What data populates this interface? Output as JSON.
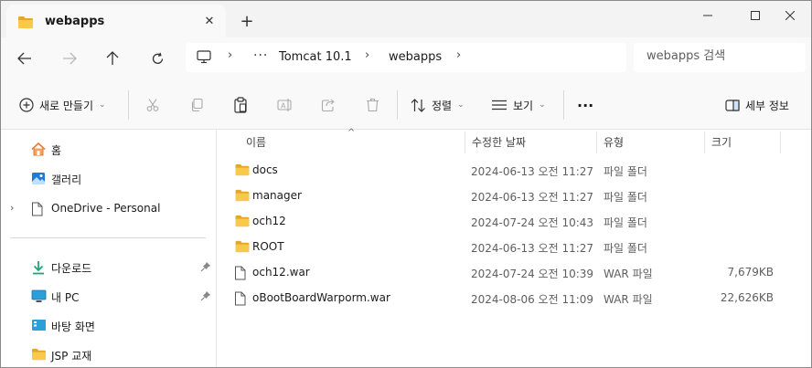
{
  "tab": {
    "title": "webapps",
    "close_glyph": "✕",
    "new_tab_glyph": "+"
  },
  "window_controls": {
    "minimize": "minimize-icon",
    "maximize": "maximize-icon",
    "close": "close-icon"
  },
  "address": {
    "overflow": "···",
    "separator": "›",
    "crumbs": [
      "Tomcat 10.1",
      "webapps"
    ]
  },
  "search": {
    "placeholder": "webapps 검색"
  },
  "toolbar": {
    "new_label": "새로 만들기",
    "sort_label": "정렬",
    "view_label": "보기",
    "more_label": "···",
    "details_label": "세부 정보",
    "chevron": "⌄"
  },
  "sidebar": {
    "items": [
      {
        "label": "홈",
        "icon": "home-icon"
      },
      {
        "label": "갤러리",
        "icon": "gallery-icon"
      },
      {
        "label": "OneDrive - Personal",
        "icon": "document-icon",
        "expand": "›"
      },
      {
        "label": "다운로드",
        "icon": "download-icon",
        "pinned": true
      },
      {
        "label": "내 PC",
        "icon": "monitor-icon",
        "pinned": true
      },
      {
        "label": "바탕 화면",
        "icon": "desktop-icon"
      },
      {
        "label": "JSP 교재",
        "icon": "folder-icon"
      }
    ]
  },
  "columns": {
    "name": "이름",
    "modified": "수정한 날짜",
    "type": "유형",
    "size": "크기",
    "sort_glyph": "^"
  },
  "files": [
    {
      "name": "docs",
      "modified": "2024-06-13 오전 11:27",
      "type": "파일 폴더",
      "size": "",
      "kind": "folder"
    },
    {
      "name": "manager",
      "modified": "2024-06-13 오전 11:27",
      "type": "파일 폴더",
      "size": "",
      "kind": "folder"
    },
    {
      "name": "och12",
      "modified": "2024-07-24 오전 10:43",
      "type": "파일 폴더",
      "size": "",
      "kind": "folder"
    },
    {
      "name": "ROOT",
      "modified": "2024-06-13 오전 11:27",
      "type": "파일 폴더",
      "size": "",
      "kind": "folder"
    },
    {
      "name": "och12.war",
      "modified": "2024-07-24 오전 10:39",
      "type": "WAR 파일",
      "size": "7,679KB",
      "kind": "file"
    },
    {
      "name": "oBootBoardWarporm.war",
      "modified": "2024-08-06 오전 11:09",
      "type": "WAR 파일",
      "size": "22,626KB",
      "kind": "file"
    }
  ],
  "colors": {
    "folder": "#f8c94a",
    "folder_dark": "#e4a72b",
    "accent": "#0067c0"
  }
}
